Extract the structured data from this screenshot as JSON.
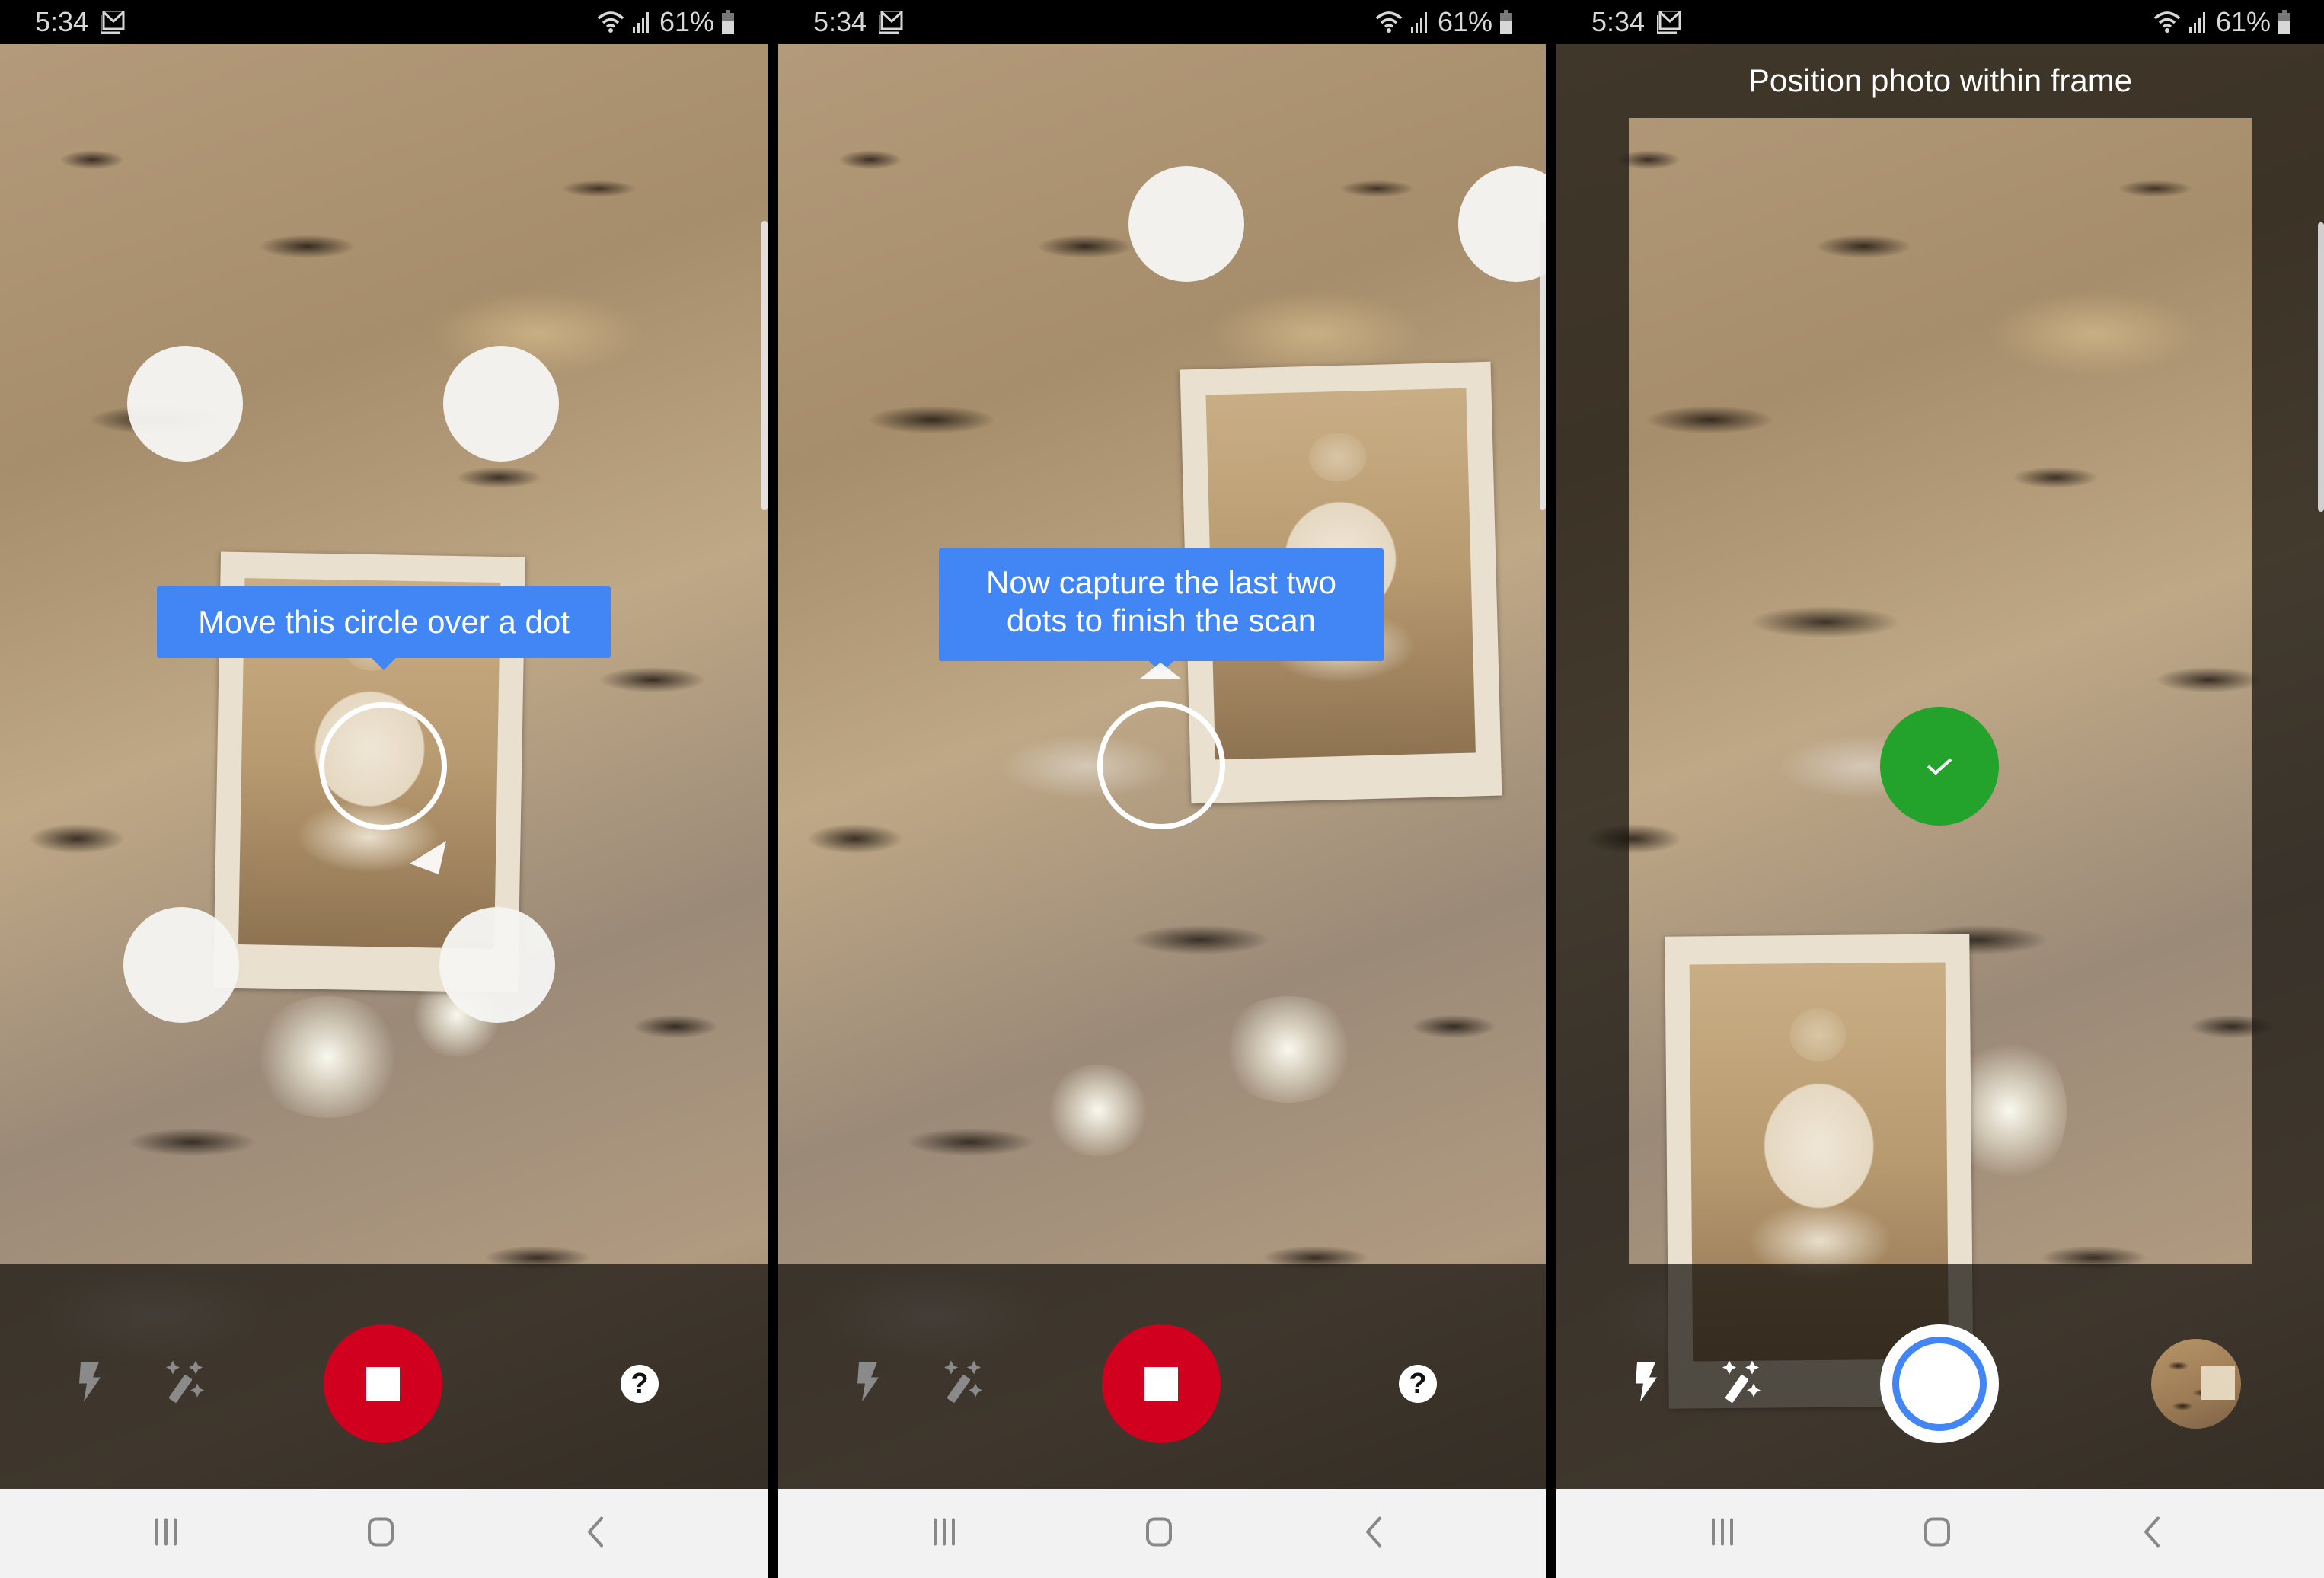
{
  "status_bar": {
    "time": "5:34",
    "notification_icon": "gmail-icon",
    "wifi_icon": "wifi-icon",
    "signal_icon": "cell-signal-icon",
    "battery_percent": "61%",
    "battery_level": 0.61
  },
  "screens": [
    {
      "id": "scan-step-1",
      "tooltip": "Move this circle over a dot",
      "target_dots": 4,
      "controls": {
        "flash": "flash-icon",
        "enhance": "magic-wand-icon",
        "primary": "stop-button",
        "help": "?"
      }
    },
    {
      "id": "scan-step-2",
      "tooltip_line1": "Now capture the last two",
      "tooltip_line2": "dots to finish the scan",
      "target_dots": 2,
      "controls": {
        "flash": "flash-icon",
        "enhance": "magic-wand-icon",
        "primary": "stop-button",
        "help": "?"
      }
    },
    {
      "id": "position-frame",
      "title": "Position photo within frame",
      "check": "check-icon",
      "controls": {
        "flash": "flash-icon",
        "enhance": "magic-wand-icon",
        "primary": "shutter-button",
        "thumbnail": "last-scan-thumbnail"
      }
    }
  ],
  "nav_bar": {
    "recents": "recents-icon",
    "home": "home-icon",
    "back": "back-icon"
  },
  "colors": {
    "tooltip_blue": "#4285f4",
    "stop_red": "#d2001f",
    "check_green": "#23a22c",
    "shutter_ring": "#4285f4",
    "nav_bg": "#f2f2f2"
  }
}
